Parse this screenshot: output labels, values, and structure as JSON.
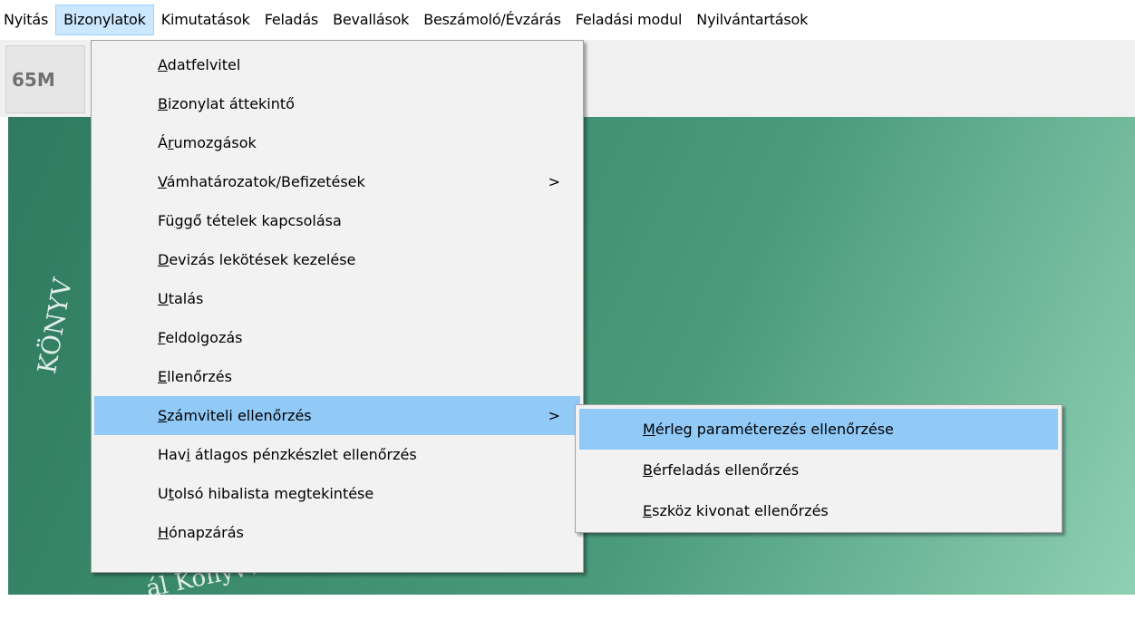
{
  "menubar": {
    "items": [
      {
        "label": "Nyitás"
      },
      {
        "label": "Bizonylatok",
        "active": true
      },
      {
        "label": "Kimutatások"
      },
      {
        "label": "Feladás"
      },
      {
        "label": "Bevallások"
      },
      {
        "label": "Beszámoló/Évzárás"
      },
      {
        "label": "Feladási modul"
      },
      {
        "label": "Nyilvántartások"
      }
    ]
  },
  "toolbar": {
    "button_label": "65M"
  },
  "desktop": {
    "emblem_left_text": "KÖNYV",
    "emblem_bottom_text": "ál Könyvvizsgálói K"
  },
  "main_menu": {
    "items": [
      {
        "pre": "",
        "ul": "A",
        "post": "datfelvitel"
      },
      {
        "pre": "",
        "ul": "B",
        "post": "izonylat áttekintő"
      },
      {
        "pre": "Á",
        "ul": "r",
        "post": "umozgások"
      },
      {
        "pre": "",
        "ul": "V",
        "post": "ámhatározatok/Befizetések",
        "submenu_indicator": ">"
      },
      {
        "pre": "Fü",
        "ul": "g",
        "post": "gő tételek kapcsolása"
      },
      {
        "pre": "",
        "ul": "D",
        "post": "evizás lekötések kezelése"
      },
      {
        "pre": "",
        "ul": "U",
        "post": "talás"
      },
      {
        "pre": "",
        "ul": "F",
        "post": "eldolgozás"
      },
      {
        "pre": "",
        "ul": "E",
        "post": "llenőrzés"
      },
      {
        "pre": "",
        "ul": "S",
        "post": "zámviteli ellenőrzés",
        "submenu_indicator": ">",
        "highlighted": true
      },
      {
        "pre": "Hav",
        "ul": "i",
        "post": " átlagos pénzkészlet ellenőrzés"
      },
      {
        "pre": "U",
        "ul": "t",
        "post": "olsó hibalista megtekintése"
      },
      {
        "pre": "",
        "ul": "H",
        "post": "ónapzárás"
      }
    ]
  },
  "sub_menu": {
    "items": [
      {
        "pre": "",
        "ul": "M",
        "post": "érleg paraméterezés ellenőrzése",
        "highlighted": true
      },
      {
        "pre": "",
        "ul": "B",
        "post": "érfeladás ellenőrzés"
      },
      {
        "pre": "",
        "ul": "E",
        "post": "szköz kivonat ellenőrzés"
      }
    ]
  }
}
